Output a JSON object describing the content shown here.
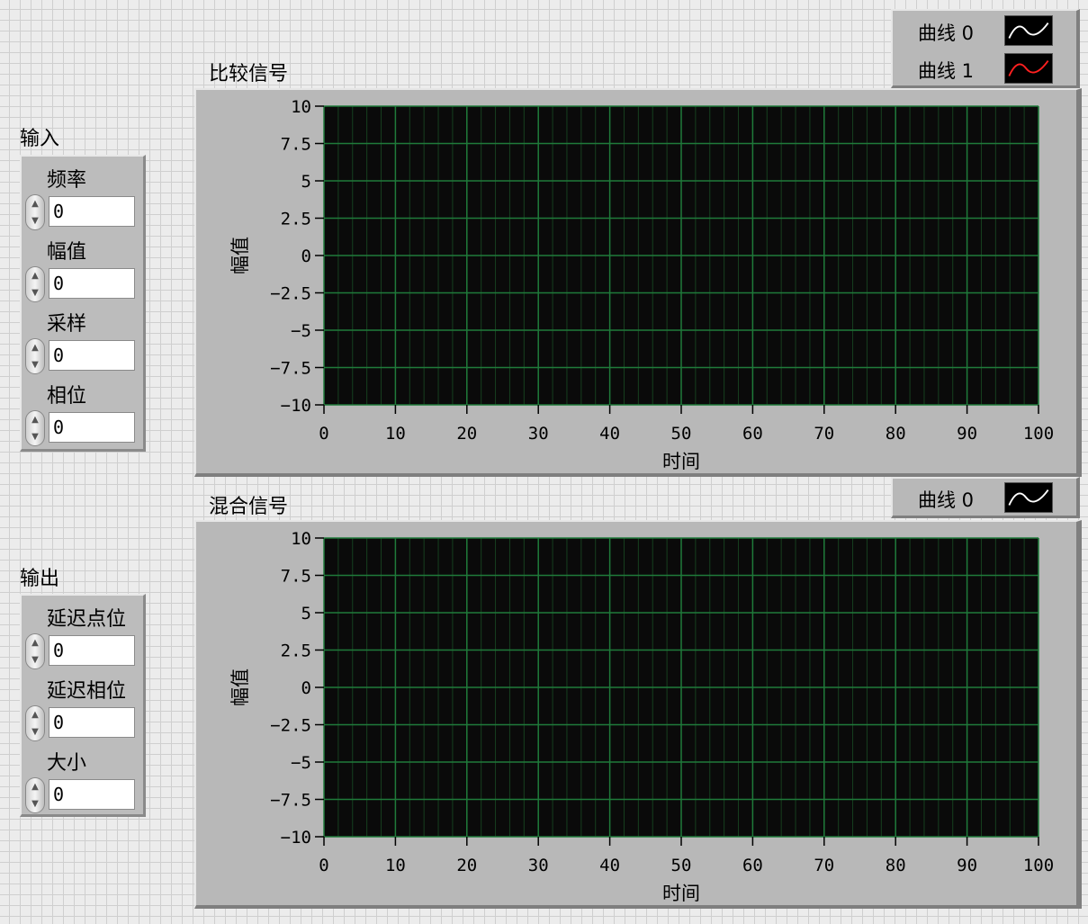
{
  "inputs": {
    "group_label": "输入",
    "controls": [
      {
        "label": "频率",
        "value": "0"
      },
      {
        "label": "幅值",
        "value": "0"
      },
      {
        "label": "采样",
        "value": "0"
      },
      {
        "label": "相位",
        "value": "0"
      }
    ]
  },
  "outputs": {
    "group_label": "输出",
    "controls": [
      {
        "label": "延迟点位",
        "value": "0"
      },
      {
        "label": "延迟相位",
        "value": "0"
      },
      {
        "label": "大小",
        "value": "0"
      }
    ]
  },
  "spin_glyphs": {
    "up": "▲",
    "down": "▼"
  },
  "graph1": {
    "title": "比较信号",
    "legend": [
      {
        "name": "曲线 0",
        "color": "#ffffff"
      },
      {
        "name": "曲线 1",
        "color": "#ff2020"
      }
    ]
  },
  "graph2": {
    "title": "混合信号",
    "legend": [
      {
        "name": "曲线 0",
        "color": "#ffffff"
      }
    ]
  },
  "chart_data": [
    {
      "type": "line",
      "title": "比较信号",
      "xlabel": "时间",
      "ylabel": "幅值",
      "xlim": [
        0,
        100
      ],
      "ylim": [
        -10,
        10
      ],
      "x_ticks": [
        "0",
        "10",
        "20",
        "30",
        "40",
        "50",
        "60",
        "70",
        "80",
        "90",
        "100"
      ],
      "y_ticks": [
        "10",
        "7.5",
        "5",
        "2.5",
        "0",
        "-2.5",
        "-5",
        "-7.5",
        "-10"
      ],
      "grid": true,
      "plot_background": "#0a0a0a",
      "grid_color": "#1f7a3a",
      "series": [
        {
          "name": "曲线 0",
          "color": "#ffffff",
          "x": [],
          "y": []
        },
        {
          "name": "曲线 1",
          "color": "#ff2020",
          "x": [],
          "y": []
        }
      ],
      "legend_position": "top-right"
    },
    {
      "type": "line",
      "title": "混合信号",
      "xlabel": "时间",
      "ylabel": "幅值",
      "xlim": [
        0,
        100
      ],
      "ylim": [
        -10,
        10
      ],
      "x_ticks": [
        "0",
        "10",
        "20",
        "30",
        "40",
        "50",
        "60",
        "70",
        "80",
        "90",
        "100"
      ],
      "y_ticks": [
        "10",
        "7.5",
        "5",
        "2.5",
        "0",
        "-2.5",
        "-5",
        "-7.5",
        "-10"
      ],
      "grid": true,
      "plot_background": "#0a0a0a",
      "grid_color": "#1f7a3a",
      "series": [
        {
          "name": "曲线 0",
          "color": "#ffffff",
          "x": [],
          "y": []
        }
      ],
      "legend_position": "top-right"
    }
  ]
}
